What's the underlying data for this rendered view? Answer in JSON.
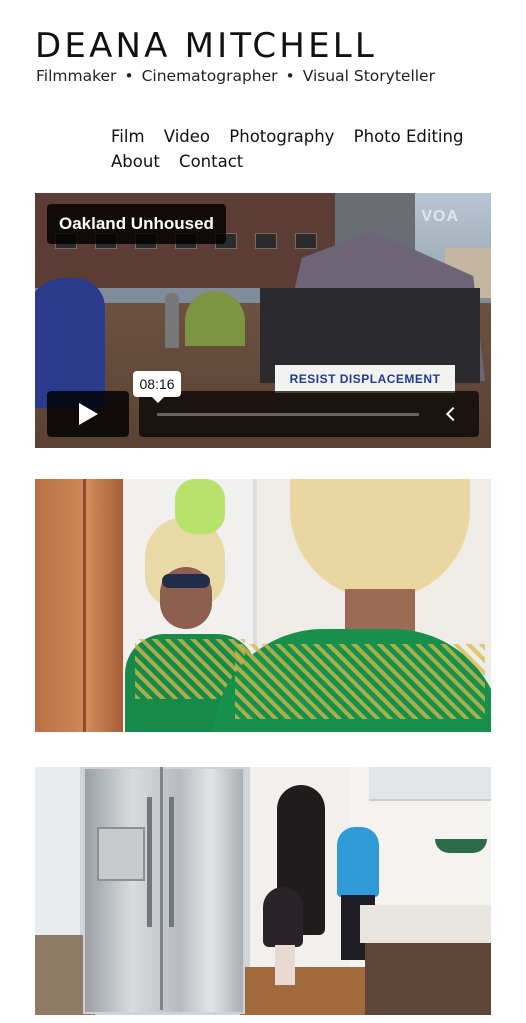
{
  "site": {
    "title": "DEANA MITCHELL",
    "tagline": [
      "Filmmaker",
      "Cinematographer",
      "Visual Storyteller"
    ],
    "tagline_separator": "•"
  },
  "nav": {
    "items": [
      "Film",
      "Video",
      "Photography",
      "Photo Editing",
      "About",
      "Contact"
    ]
  },
  "gallery": [
    {
      "kind": "video",
      "title": "Oakland Unhoused",
      "duration": "08:16",
      "logo": "VOA",
      "banner_text": "RESIST DISPLACEMENT",
      "icons": [
        "play-icon",
        "chevron-left-icon"
      ]
    },
    {
      "kind": "image",
      "subject": "mirror-portrait"
    },
    {
      "kind": "image",
      "subject": "kitchen-family"
    }
  ],
  "colors": {
    "text": "#111111",
    "background": "#ffffff",
    "overlay": "#000000"
  }
}
